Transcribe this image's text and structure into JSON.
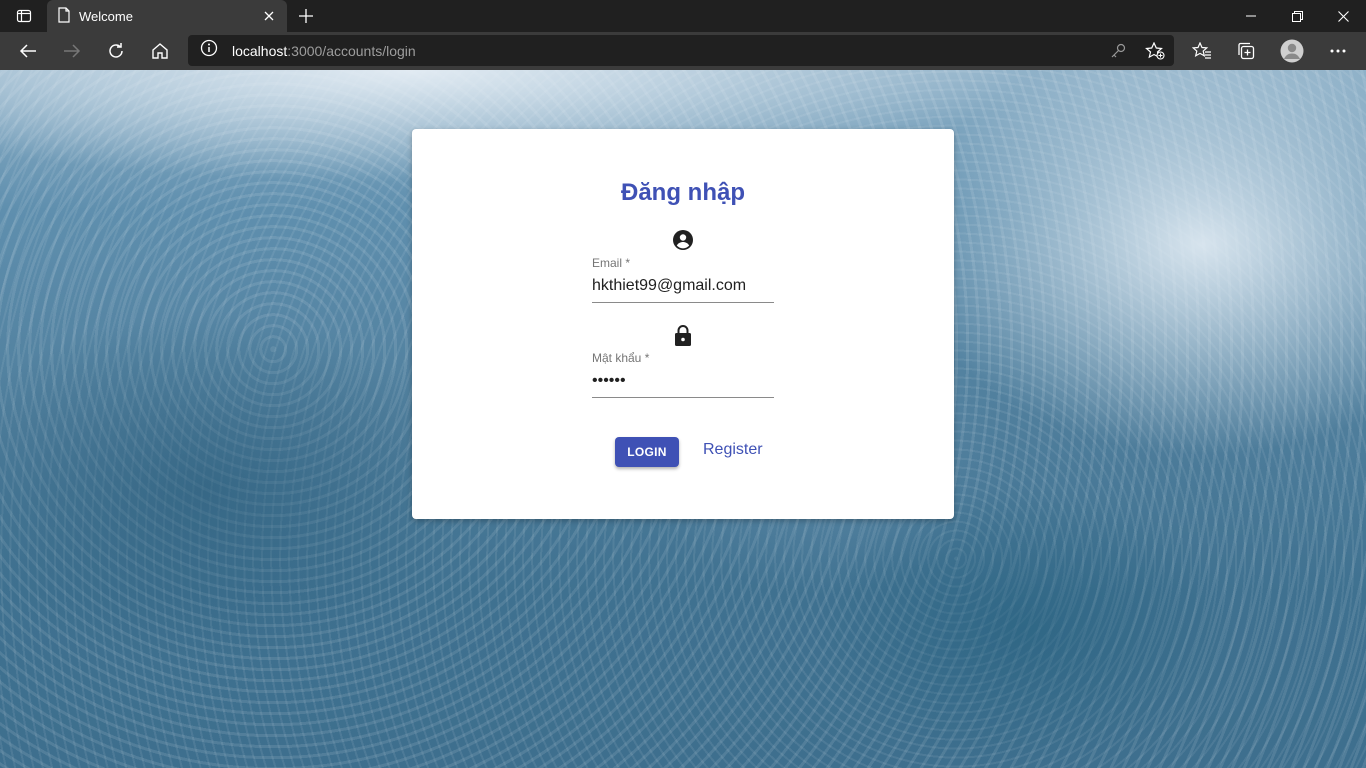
{
  "browser": {
    "tab_title": "Welcome",
    "url_host": "localhost",
    "url_rest": ":3000/accounts/login"
  },
  "login": {
    "heading": "Đăng nhập",
    "email_label": "Email *",
    "email_value": "hkthiet99@gmail.com",
    "password_label": "Mật khẩu *",
    "password_value": "••••••",
    "login_button": "LOGIN",
    "register_link": "Register"
  },
  "colors": {
    "primary": "#3f51b5",
    "browser_dark": "#202020",
    "browser_toolbar": "#3b3b3b"
  },
  "icons": {
    "email_field": "account-circle-icon",
    "password_field": "lock-icon"
  }
}
